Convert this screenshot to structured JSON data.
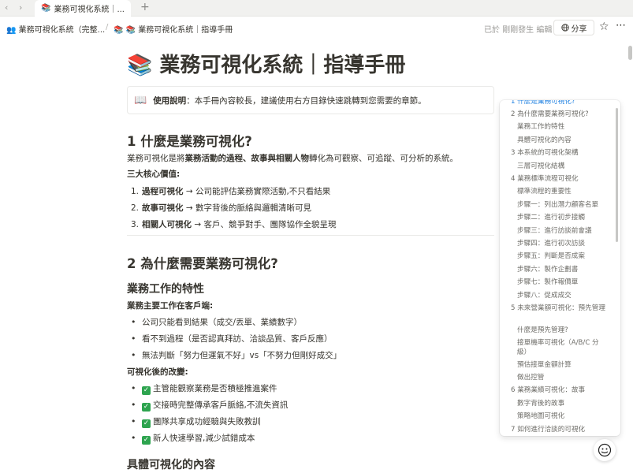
{
  "tabbar": {
    "tab_title": "業務可視化系統｜...",
    "tab_icon": "📚",
    "back_glyph": "‹",
    "forward_glyph": "›",
    "new_tab_glyph": "+"
  },
  "topbar": {
    "breadcrumb_parent": "業務可視化系統（完整...",
    "breadcrumb_sep": "/",
    "breadcrumb_current": "📚 業務可視化系統｜指導手冊",
    "edited_status": "已於 剛剛發生 編輯",
    "share_label": "分享"
  },
  "page": {
    "title": "📚 業務可視化系統｜指導手冊",
    "callout_icon": "📖",
    "callout_label": "使用說明",
    "callout_text": "：本手冊內容較長，建議使用右方目錄快速跳轉到您需要的章節。"
  },
  "sections": {
    "s1_heading": "1 什麼是業務可視化?",
    "s1_intro_a": "業務可視化是將",
    "s1_intro_bold": "業務活動的過程、故事與相關人物",
    "s1_intro_b": "轉化為可觀察、可追蹤、可分析的系統。",
    "s1_values_heading": "三大核心價值:",
    "s1_values": [
      {
        "num": "1.",
        "bold": "過程可視化",
        "text": " → 公司能評估業務實際活動,不只看結果"
      },
      {
        "num": "2.",
        "bold": "故事可視化",
        "text": " → 數字背後的脈絡與邏輯清晰可見"
      },
      {
        "num": "3.",
        "bold": "相關人可視化",
        "text": " → 客戶、競爭對手、團隊協作全貌呈現"
      }
    ],
    "s2_heading": "2 為什麼需要業務可視化?",
    "s2_sub1": "業務工作的特性",
    "s2_sub1_label": "業務主要工作在客戶端:",
    "s2_bullets1": [
      "公司只能看到結果（成交/丟單、業績數字）",
      "看不到過程（是否認真拜訪、洽談品質、客戶反應）",
      "無法判斷「努力但運氣不好」vs「不努力但剛好成交」"
    ],
    "s2_after_label": "可視化後的改變:",
    "s2_bullets2": [
      "主管能觀察業務是否積極推進案件",
      "交接時完整傳承客戶脈絡,不流失資訊",
      "團隊共享成功經驗與失敗教訓",
      "新人快速學習,減少試錯成本"
    ],
    "s2_sub2": "具體可視化的內容"
  },
  "toc": {
    "items": [
      "1 什麼是業務可視化?",
      "2 為什麼需要業務可視化?",
      "業務工作的特性",
      "具體可視化的內容",
      "3 本系統的可視化架構",
      "三層可視化結構",
      "4 業務標準流程可視化",
      "標準流程的重要性",
      "步驟一：列出潛力顧客名單",
      "步驟二：進行初步接觸",
      "步驟三：進行訪談前會議",
      "步驟四：進行初次訪談",
      "步驟五：判斷是否成案",
      "步驟六：製作企劃書",
      "步驟七：製作報價單",
      "步驟八：促成成交",
      "5 未來營業額可視化：預先管理",
      "什麼是預先管理?",
      "接單機率可視化（A/B/C 分級）",
      "預估接單金額計算",
      "做出控管",
      "6 業務業績可視化：故事",
      "數字背後的故事",
      "策略地圖可視化",
      "7 如何進行洽談的可視化"
    ]
  },
  "colors": {
    "accent": "#2383e2",
    "text": "#37352f",
    "muted": "#9b9a97",
    "check_green": "#2ea44f"
  }
}
